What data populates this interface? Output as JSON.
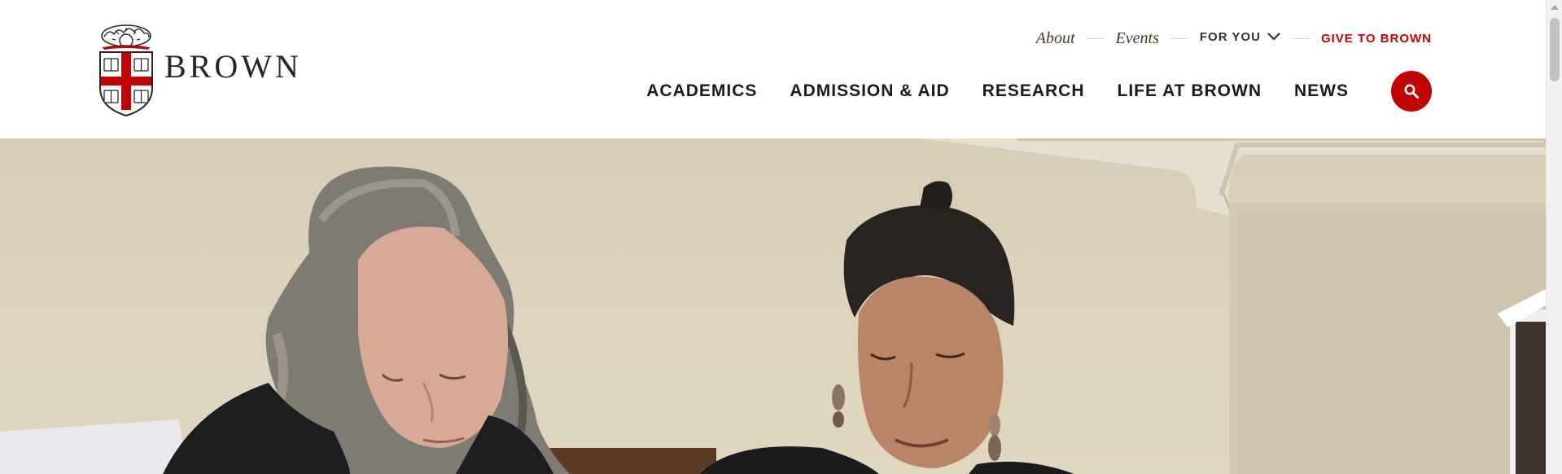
{
  "site": {
    "wordmark": "BROWN"
  },
  "utility_nav": {
    "about": "About",
    "events": "Events",
    "for_you": "FOR YOU",
    "give": "GIVE TO BROWN"
  },
  "main_nav": {
    "items": [
      "ACADEMICS",
      "ADMISSION & AID",
      "RESEARCH",
      "LIFE AT BROWN",
      "NEWS"
    ]
  },
  "icons": {
    "logo": "brown-shield-icon",
    "chevron": "chevron-down-icon",
    "search": "search-icon"
  },
  "colors": {
    "brand_red": "#c00404",
    "brand_brown": "#4e3629",
    "nav_text": "#1c1b1b"
  }
}
